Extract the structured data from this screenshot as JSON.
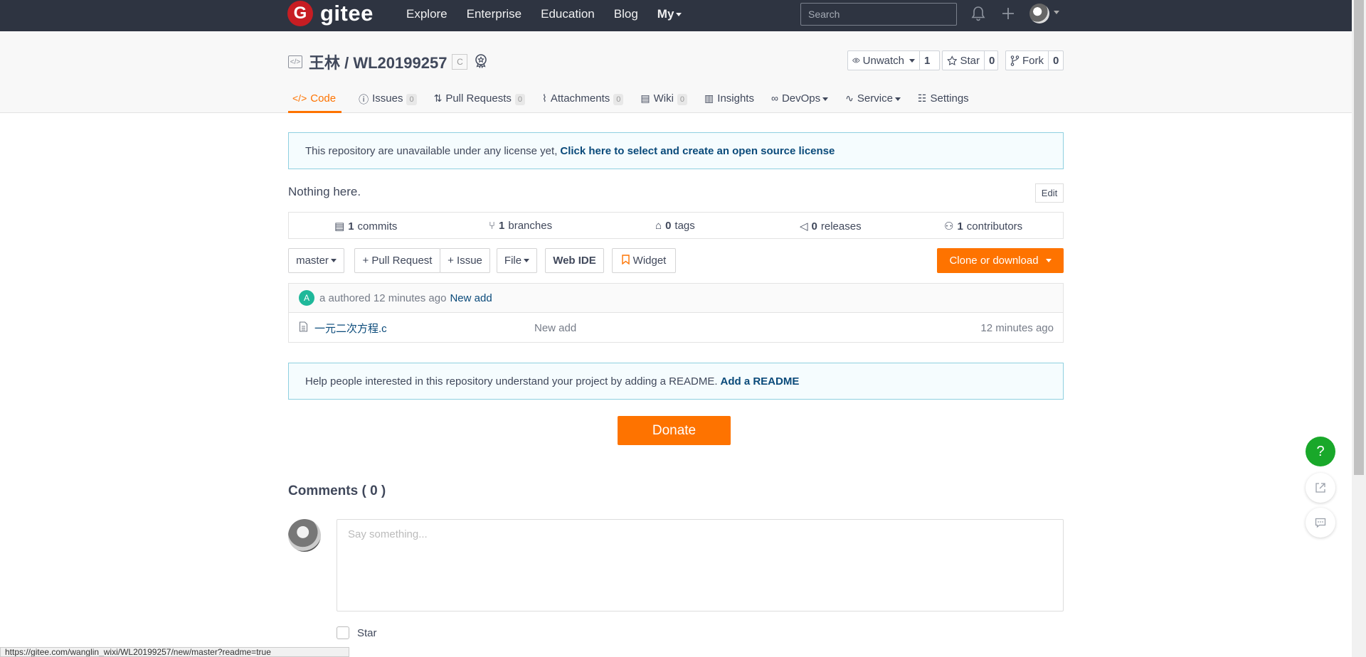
{
  "navbar": {
    "brand": "gitee",
    "links": [
      "Explore",
      "Enterprise",
      "Education",
      "Blog"
    ],
    "my_label": "My",
    "search_placeholder": "Search"
  },
  "repo": {
    "title": "王林 / WL20199257",
    "lang_badge": "C",
    "watch": {
      "label": "Unwatch",
      "count": "1"
    },
    "star": {
      "label": "Star",
      "count": "0"
    },
    "fork": {
      "label": "Fork",
      "count": "0"
    }
  },
  "tabs": [
    {
      "label": "Code",
      "badge": ""
    },
    {
      "label": "Issues",
      "badge": "0"
    },
    {
      "label": "Pull Requests",
      "badge": "0"
    },
    {
      "label": "Attachments",
      "badge": "0"
    },
    {
      "label": "Wiki",
      "badge": "0"
    },
    {
      "label": "Insights",
      "badge": ""
    },
    {
      "label": "DevOps",
      "badge": ""
    },
    {
      "label": "Service",
      "badge": ""
    },
    {
      "label": "Settings",
      "badge": ""
    }
  ],
  "license_notice": {
    "text": "This repository are unavailable under any license yet,",
    "link": "Click here to select and create an open source license"
  },
  "description": "Nothing here.",
  "edit_label": "Edit",
  "stats": {
    "commits": {
      "count": "1",
      "label": "commits"
    },
    "branches": {
      "count": "1",
      "label": "branches"
    },
    "tags": {
      "count": "0",
      "label": "tags"
    },
    "releases": {
      "count": "0",
      "label": "releases"
    },
    "contributors": {
      "count": "1",
      "label": "contributors"
    }
  },
  "toolbar": {
    "branch": "master",
    "pull_request": "+ Pull Request",
    "issue": "+ Issue",
    "file": "File",
    "web_ide": "Web IDE",
    "widget": "Widget",
    "clone": "Clone or download"
  },
  "last_commit": {
    "avatar_letter": "A",
    "author_text": "a authored 12 minutes ago",
    "message": "New add"
  },
  "files": [
    {
      "name": "一元二次方程.c",
      "message": "New add",
      "time": "12 minutes ago"
    }
  ],
  "readme_notice": {
    "text": "Help people interested in this repository understand your project by adding a README.",
    "link": "Add a README"
  },
  "donate_label": "Donate",
  "comments": {
    "title": "Comments ( 0 )",
    "placeholder": "Say something...",
    "star_label": "Star"
  },
  "status_url": "https://gitee.com/wanglin_wixi/WL20199257/new/master?readme=true",
  "help_label": "?"
}
